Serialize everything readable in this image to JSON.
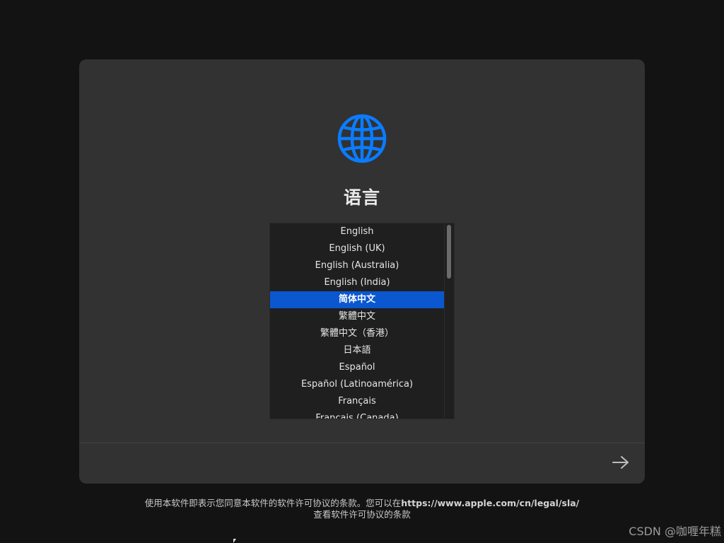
{
  "panel": {
    "title": "语言",
    "globe_icon": "globe-icon",
    "accent_color": "#0a7cff",
    "selected_color": "#0a57d0",
    "languages": [
      {
        "label": "English",
        "selected": false
      },
      {
        "label": "English (UK)",
        "selected": false
      },
      {
        "label": "English (Australia)",
        "selected": false
      },
      {
        "label": "English (India)",
        "selected": false
      },
      {
        "label": "简体中文",
        "selected": true
      },
      {
        "label": "繁體中文",
        "selected": false
      },
      {
        "label": "繁體中文（香港）",
        "selected": false
      },
      {
        "label": "日本語",
        "selected": false
      },
      {
        "label": "Español",
        "selected": false
      },
      {
        "label": "Español (Latinoamérica)",
        "selected": false
      },
      {
        "label": "Français",
        "selected": false
      },
      {
        "label": "Français (Canada)",
        "selected": false
      }
    ],
    "next_icon": "arrow-right-icon"
  },
  "footer": {
    "line1_prefix": "使用本软件即表示您同意本软件的软件许可协议的条款。您可以在",
    "link": "https://www.apple.com/cn/legal/sla/",
    "line2": "查看软件许可协议的条款"
  },
  "watermark": "CSDN @咖喱年糕"
}
